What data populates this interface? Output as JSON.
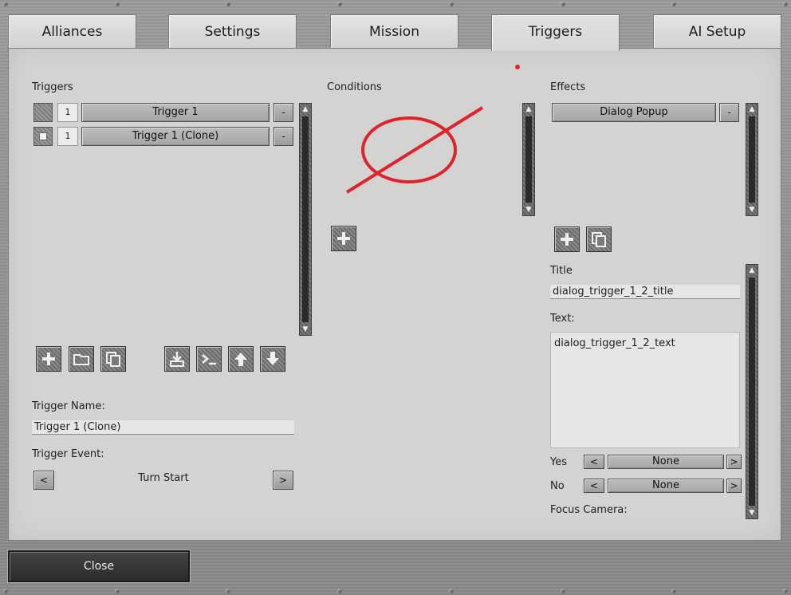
{
  "tabs": [
    {
      "label": "Alliances"
    },
    {
      "label": "Settings"
    },
    {
      "label": "Mission"
    },
    {
      "label": "Triggers"
    },
    {
      "label": "AI Setup"
    }
  ],
  "active_tab": "Triggers",
  "triggers_panel": {
    "heading": "Triggers",
    "items": [
      {
        "number": "1",
        "name": "Trigger 1",
        "remove_label": "-"
      },
      {
        "number": "1",
        "name": "Trigger 1 (Clone)",
        "remove_label": "-"
      }
    ]
  },
  "conditions_panel": {
    "heading": "Conditions"
  },
  "effects_panel": {
    "heading": "Effects",
    "items": [
      {
        "name": "Dialog Popup",
        "remove_label": "-"
      }
    ]
  },
  "trigger_details": {
    "name_label": "Trigger Name:",
    "name_value": "Trigger 1 (Clone)",
    "event_label": "Trigger Event:",
    "event_value": "Turn Start",
    "prev_label": "<",
    "next_label": ">"
  },
  "effect_details": {
    "title_label": "Title",
    "title_value": "dialog_trigger_1_2_title",
    "text_label": "Text:",
    "text_value": "dialog_trigger_1_2_text",
    "yes_label": "Yes",
    "yes_value": "None",
    "no_label": "No",
    "no_value": "None",
    "focus_camera_label": "Focus Camera:",
    "prev_label": "<",
    "next_label": ">"
  },
  "footer": {
    "close_label": "Close"
  },
  "colors": {
    "panel": "#d3d3d2",
    "no_entry_symbol": "#e0232b"
  },
  "icons": {
    "triggers_toolbar": [
      "plus-icon",
      "folder-icon",
      "copy-icon",
      "import-icon",
      "console-icon",
      "arrow-up-icon",
      "arrow-down-icon"
    ],
    "conditions_toolbar": [
      "plus-icon"
    ],
    "effects_toolbar": [
      "plus-icon",
      "copy-icon"
    ]
  }
}
